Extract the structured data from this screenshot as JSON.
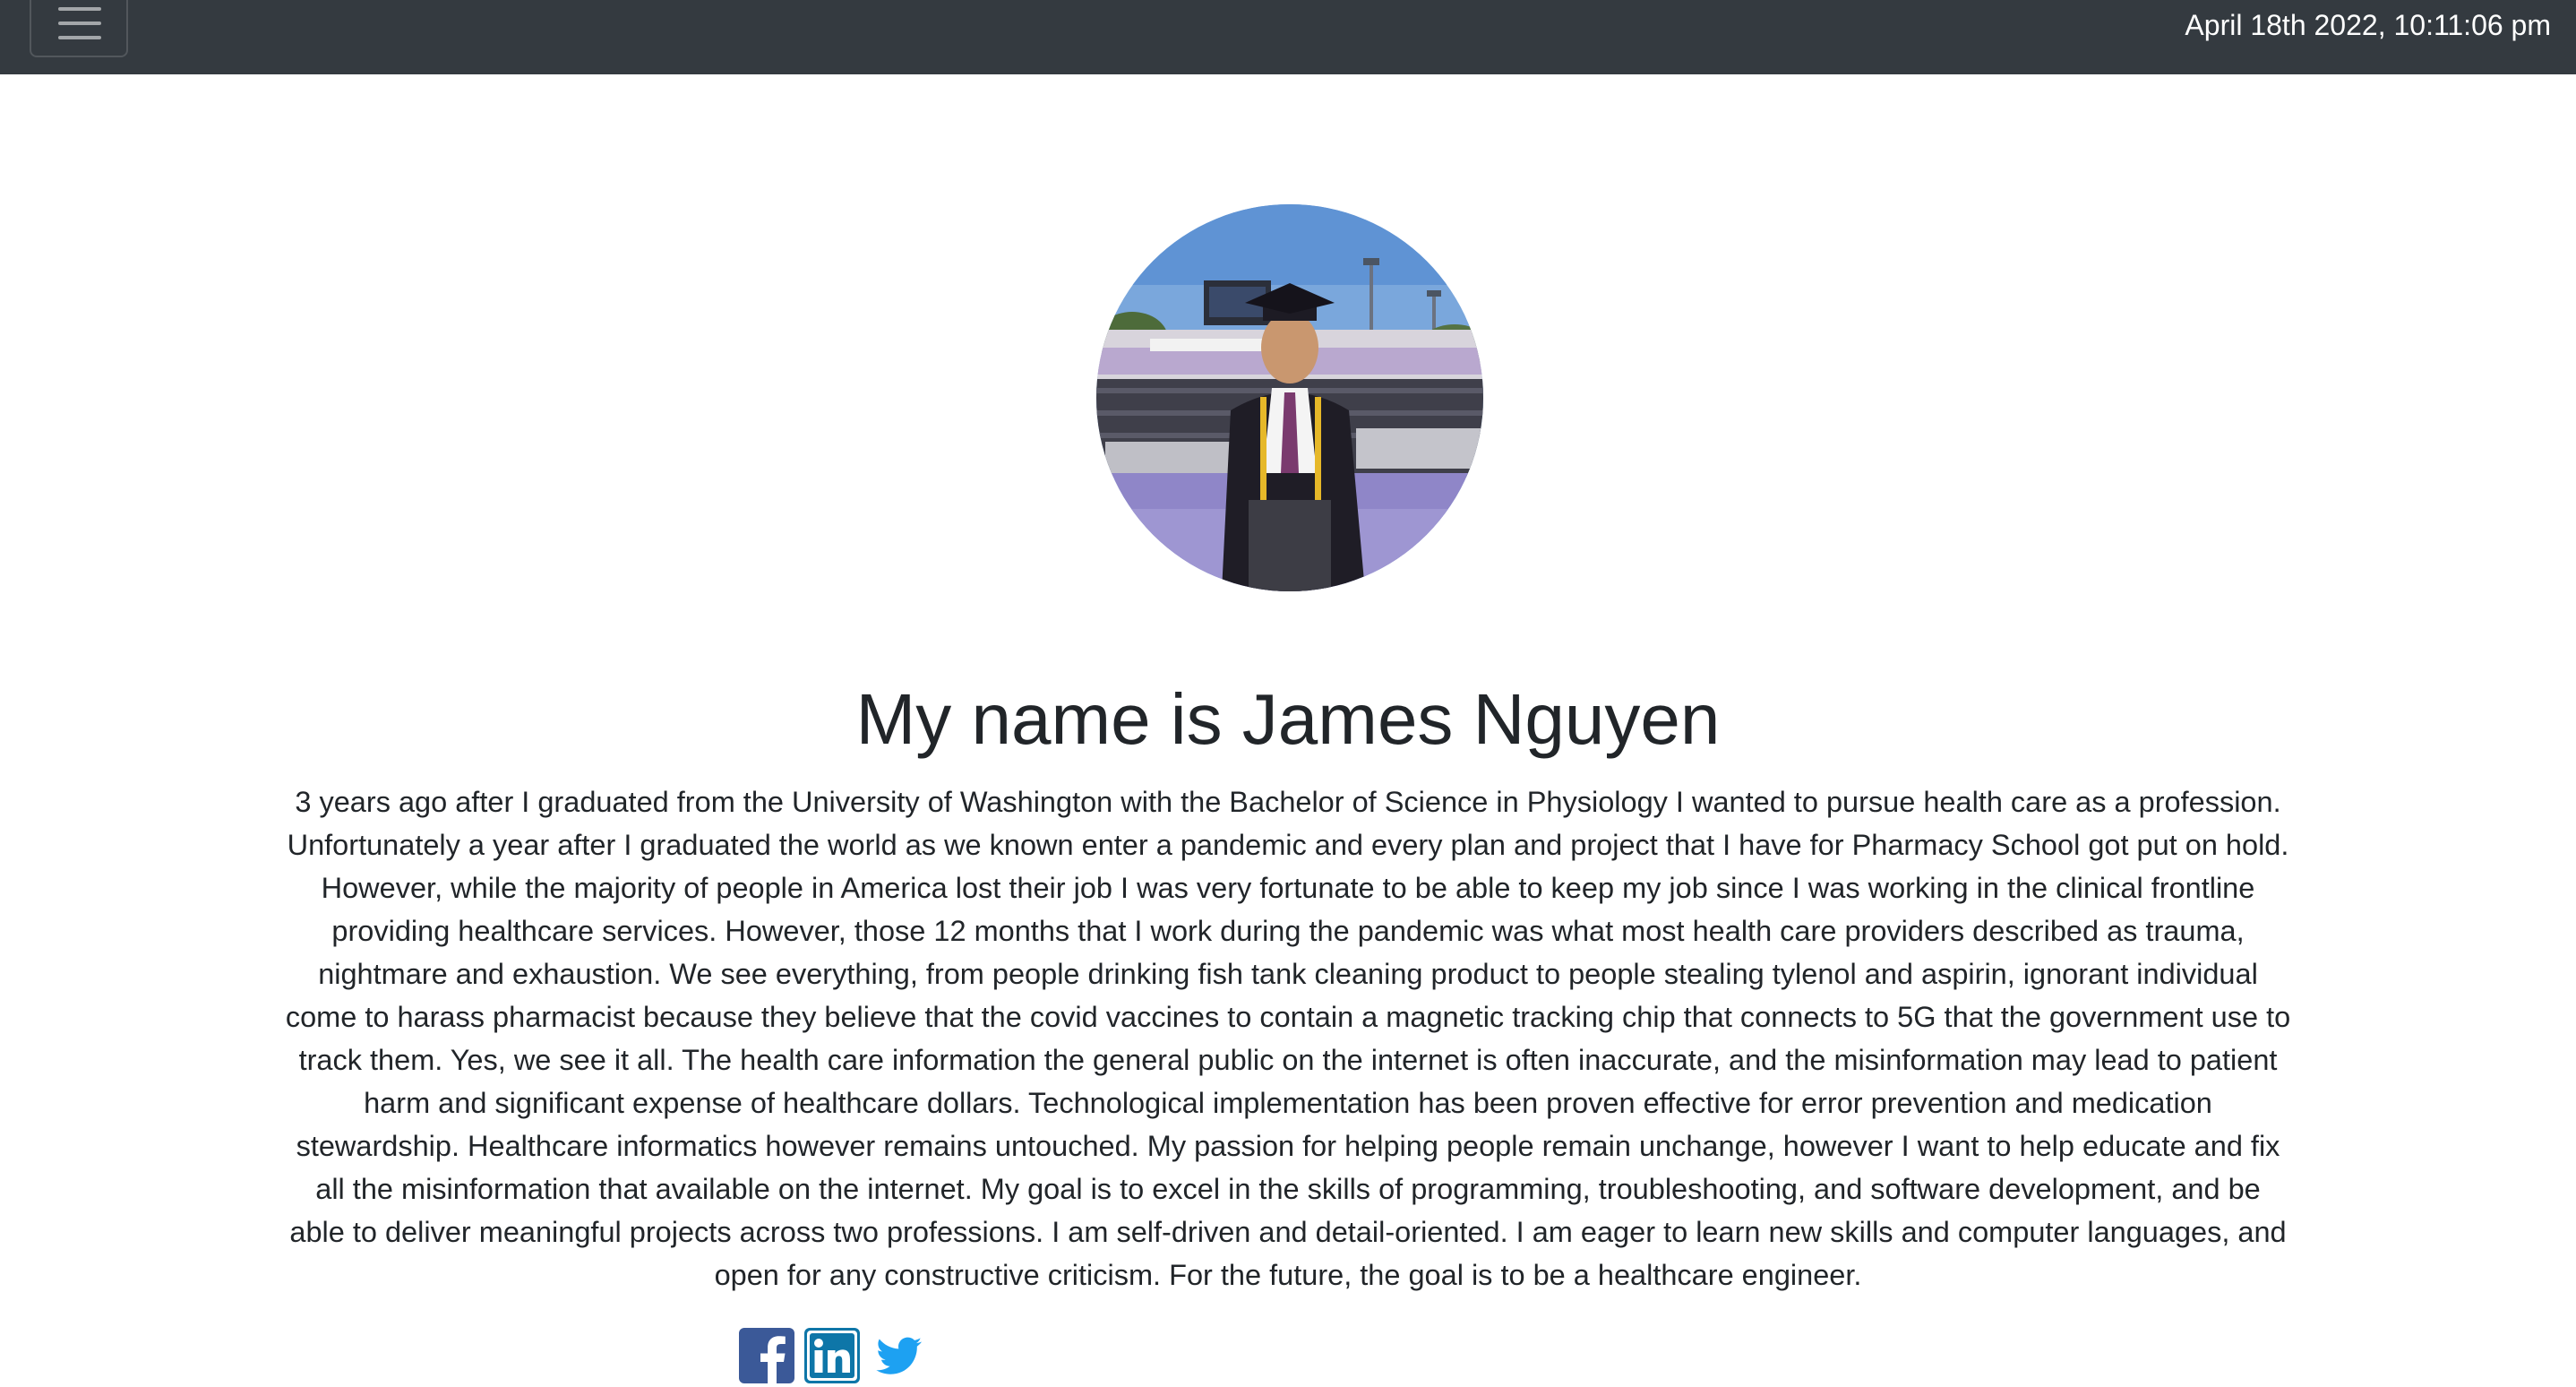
{
  "header": {
    "menu_icon": "hamburger-menu-icon",
    "datetime": "April 18th 2022, 10:11:06 pm"
  },
  "profile": {
    "photo": "graduation-photo",
    "heading": "My name is James Nguyen",
    "bio": "3 years ago after I graduated from the University of Washington with the Bachelor of Science in Physiology I wanted to pursue health care as a profession. Unfortunately a year after I graduated the world as we known enter a pandemic and every plan and project that I have for Pharmacy School got put on hold. However, while the majority of people in America lost their job I was very fortunate to be able to keep my job since I was working in the clinical frontline providing healthcare services. However, those 12 months that I work during the pandemic was what most health care providers described as trauma, nightmare and exhaustion. We see everything, from people drinking fish tank cleaning product to people stealing tylenol and aspirin, ignorant individual come to harass pharmacist because they believe that the covid vaccines to contain a magnetic tracking chip that connects to 5G that the government use to track them. Yes, we see it all. The health care information the general public on the internet is often inaccurate, and the misinformation may lead to patient harm and significant expense of healthcare dollars. Technological implementation has been proven effective for error prevention and medication stewardship. Healthcare informatics however remains untouched. My passion for helping people remain unchange, however I want to help educate and fix all the misinformation that available on the internet. My goal is to excel in the skills of programming, troubleshooting, and software development, and be able to deliver meaningful projects across two professions. I am self-driven and detail-oriented. I am eager to learn new skills and computer languages, and open for any constructive criticism. For the future, the goal is to be a healthcare engineer."
  },
  "social": [
    {
      "icon": "facebook-icon",
      "color": "#3b5998"
    },
    {
      "icon": "linkedin-icon",
      "color": "#0e76a8"
    },
    {
      "icon": "twitter-icon",
      "color": "#1da1f2"
    }
  ],
  "colors": {
    "navbar": "#343a40",
    "text": "#212529",
    "background": "#ffffff"
  }
}
